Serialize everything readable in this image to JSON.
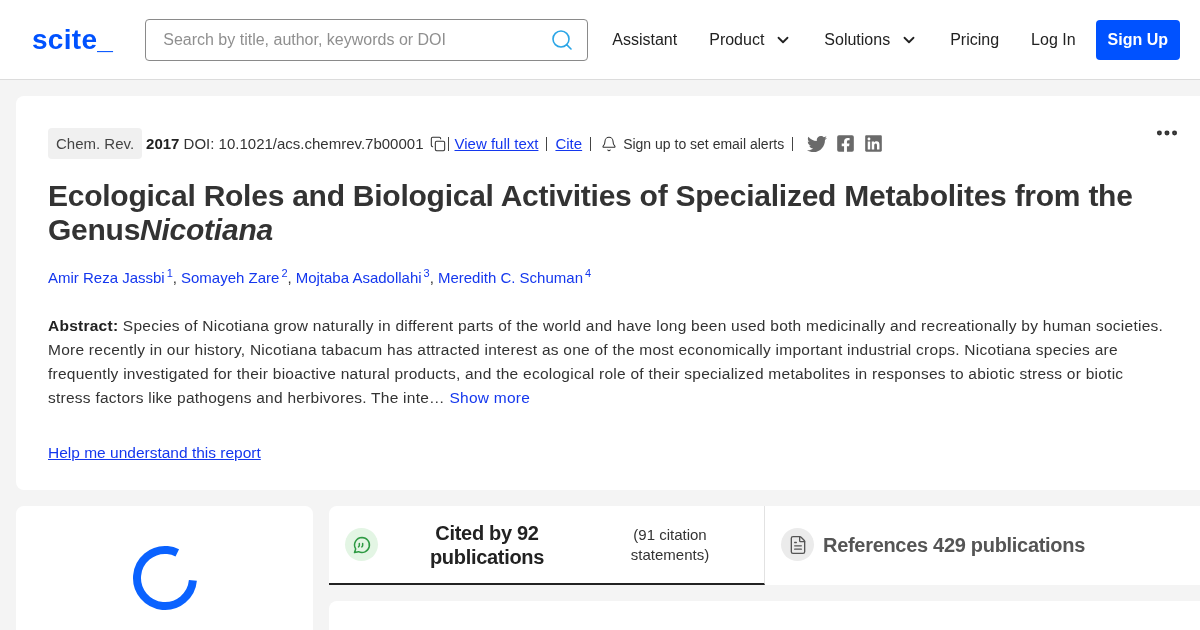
{
  "header": {
    "logo": "scite_",
    "search": {
      "placeholder": "Search by title, author, keywords or DOI"
    },
    "nav": [
      {
        "label": "Assistant",
        "kind": "link"
      },
      {
        "label": "Product",
        "kind": "dropdown"
      },
      {
        "label": "Solutions",
        "kind": "dropdown"
      },
      {
        "label": "Pricing",
        "kind": "link"
      },
      {
        "label": "Log In",
        "kind": "link"
      },
      {
        "label": "Sign Up",
        "kind": "button"
      }
    ]
  },
  "article": {
    "journal": "Chem. Rev.",
    "publication": "**2017** DOI: 10.1021/acs.chemrev.7b00001",
    "links": [
      "View full text",
      "Cite"
    ],
    "alert": "Sign up to set email alerts",
    "title_parts": [
      {
        "text": "Ecological Roles and Biological Activities of Specialized Metabolites from the Genus",
        "italic": false
      },
      {
        "text": "Nicotiana",
        "italic": true
      }
    ],
    "authors": [
      {
        "name": "Amir Reza Jassbi",
        "affiliation": "1"
      },
      {
        "name": "Somayeh Zare",
        "affiliation": "2"
      },
      {
        "name": "Mojtaba Asadollahi",
        "affiliation": "3"
      },
      {
        "name": "Meredith C. Schuman",
        "affiliation": "4"
      }
    ],
    "author_separator": ",",
    "abstract": "**Abstract:** Species of Nicotiana grow naturally in different parts of the world and have long been used both medicinally and recreationally by human societies. More recently in our history, Nicotiana tabacum has attracted interest as one of the most economically important industrial crops. Nicotiana species are frequently investigated for their bioactive natural products, and the ecological role of their specialized metabolites in responses to abiotic stress or biotic stress factors like pathogens and herbivores. The inte…",
    "show_more": "Show more",
    "help_link": "Help me understand this report"
  },
  "tabs": [
    {
      "kind": "citations",
      "title": "Cited by 92 publications",
      "subtitle": "(91 citation statements)",
      "selected": true
    },
    {
      "kind": "references",
      "title": "References 429 publications",
      "selected": false
    }
  ]
}
